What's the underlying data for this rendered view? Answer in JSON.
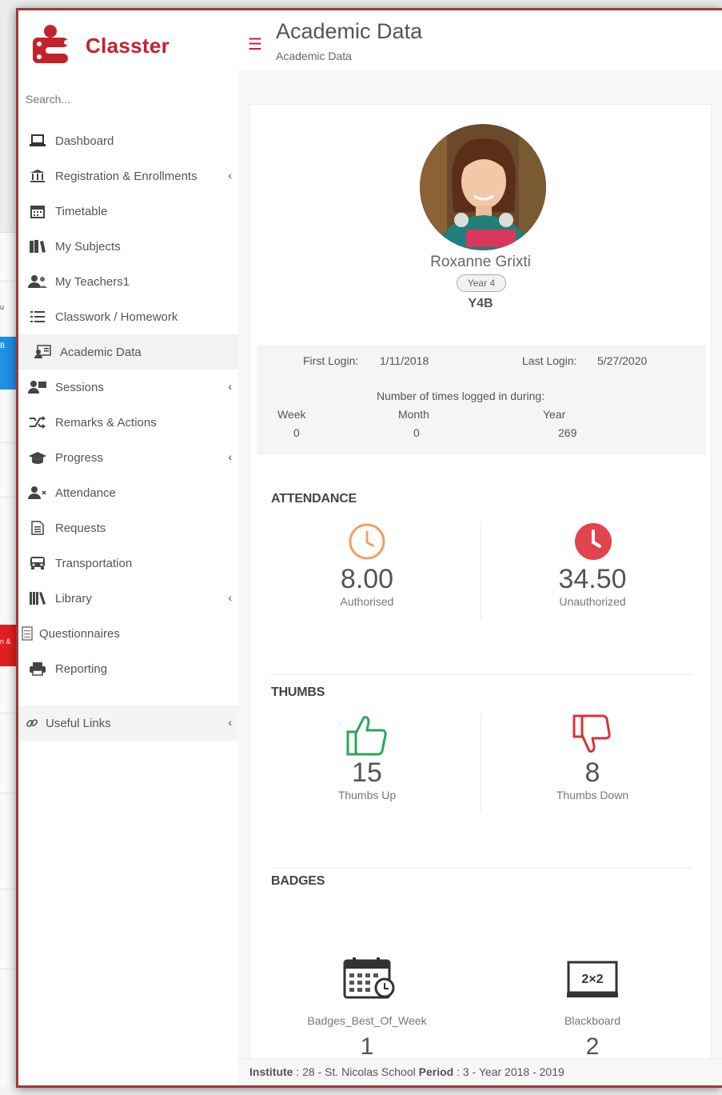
{
  "app": {
    "brand": "Classter"
  },
  "search": {
    "placeholder": "Search..."
  },
  "sidebar": {
    "items": [
      {
        "label": "Dashboard",
        "icon": "laptop-icon",
        "chevron": false
      },
      {
        "label": "Registration & Enrollments",
        "icon": "bank-icon",
        "chevron": true
      },
      {
        "label": "Timetable",
        "icon": "calendar-icon",
        "chevron": false
      },
      {
        "label": "My Subjects",
        "icon": "books-icon",
        "chevron": false
      },
      {
        "label": "My Teachers1",
        "icon": "users-icon",
        "chevron": false
      },
      {
        "label": "Classwork / Homework",
        "icon": "list-icon",
        "chevron": false
      },
      {
        "label": "Academic Data",
        "icon": "id-card-icon",
        "chevron": false,
        "active": true
      },
      {
        "label": "Sessions",
        "icon": "user-sessions-icon",
        "chevron": true
      },
      {
        "label": "Remarks & Actions",
        "icon": "shuffle-icon",
        "chevron": false
      },
      {
        "label": "Progress",
        "icon": "graduation-cap-icon",
        "chevron": true
      },
      {
        "label": "Attendance",
        "icon": "user-times-icon",
        "chevron": false
      },
      {
        "label": "Requests",
        "icon": "document-icon",
        "chevron": false
      },
      {
        "label": "Transportation",
        "icon": "bus-icon",
        "chevron": false
      },
      {
        "label": "Library",
        "icon": "library-icon",
        "chevron": true
      },
      {
        "label": "Questionnaires",
        "icon": "questionnaire-icon",
        "chevron": false
      },
      {
        "label": "Reporting",
        "icon": "printer-icon",
        "chevron": false
      }
    ],
    "useful_links": {
      "label": "Useful Links",
      "icon": "link-icon"
    }
  },
  "header": {
    "title": "Academic Data",
    "breadcrumb": "Academic Data"
  },
  "student": {
    "name": "Roxanne Grixti",
    "year": "Year 4",
    "class": "Y4B"
  },
  "login": {
    "first_label": "First Login:",
    "first_value": "1/11/2018",
    "last_label": "Last Login:",
    "last_value": "5/27/2020",
    "times_label": "Number of times logged in during:",
    "week_label": "Week",
    "week_value": "0",
    "month_label": "Month",
    "month_value": "0",
    "year_label": "Year",
    "year_value": "269"
  },
  "attendance": {
    "title": "ATTENDANCE",
    "authorised_value": "8.00",
    "authorised_label": "Authorised",
    "unauthorized_value": "34.50",
    "unauthorized_label": "Unauthorized",
    "colors": {
      "authorised": "#f0a060",
      "unauthorized": "#e0444e"
    }
  },
  "thumbs": {
    "title": "THUMBS",
    "up_value": "15",
    "up_label": "Thumbs Up",
    "down_value": "8",
    "down_label": "Thumbs Down",
    "colors": {
      "up": "#2aa65a",
      "down": "#d8333a"
    }
  },
  "badges": {
    "title": "BADGES",
    "items": [
      {
        "name": "Badges_Best_Of_Week",
        "count": "1",
        "icon": "calendar-clock-icon"
      },
      {
        "name": "Blackboard",
        "count": "2",
        "icon": "blackboard-icon",
        "board_text": "2×2"
      }
    ]
  },
  "footer": {
    "institute_label": "Institute",
    "institute_value": ": 28 - St. Nicolas School",
    "period_label": "Period",
    "period_value": ": 3 - Year 2018 - 2019"
  },
  "background": {
    "fragment_1": "u",
    "fragment_2": "B",
    "fragment_3": "n &"
  }
}
